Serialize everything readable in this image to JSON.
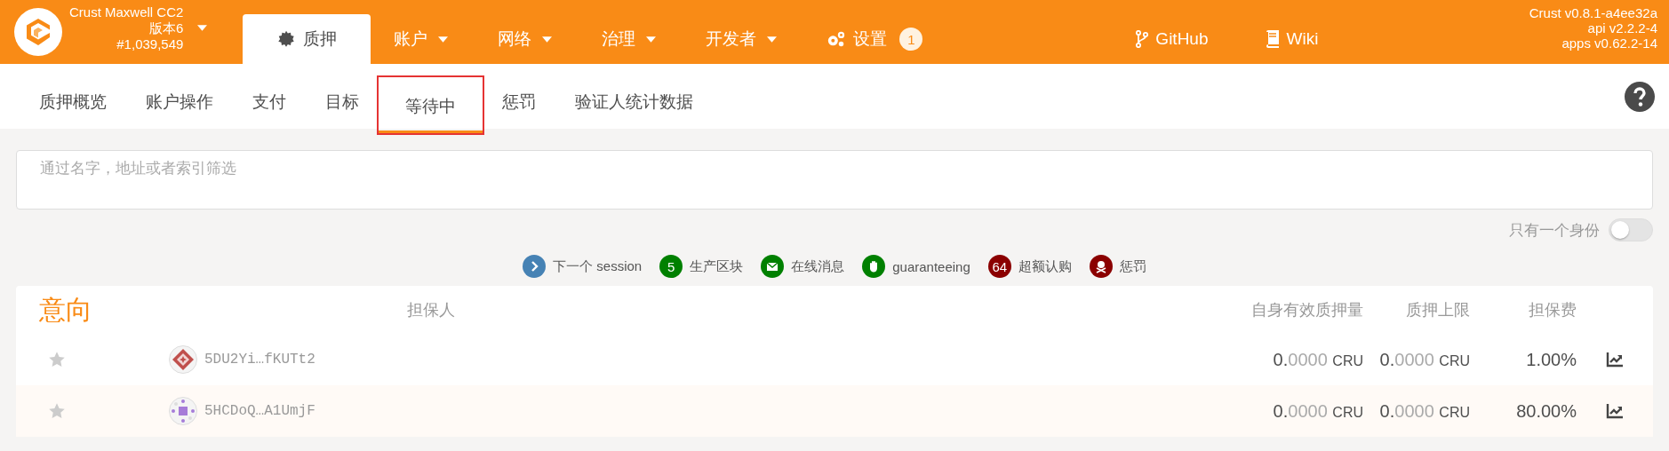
{
  "chain": {
    "name": "Crust Maxwell CC2",
    "version": "版本6",
    "block": "#1,039,549"
  },
  "nav": [
    {
      "label": "质押",
      "selected": true,
      "dropdown": false
    },
    {
      "label": "账户",
      "selected": false,
      "dropdown": true
    },
    {
      "label": "网络",
      "selected": false,
      "dropdown": true
    },
    {
      "label": "治理",
      "selected": false,
      "dropdown": true
    },
    {
      "label": "开发者",
      "selected": false,
      "dropdown": true
    },
    {
      "label": "设置",
      "selected": false,
      "dropdown": false,
      "badge": "1"
    }
  ],
  "links": [
    {
      "label": "GitHub"
    },
    {
      "label": "Wiki"
    }
  ],
  "versions": [
    "Crust v0.8.1-a4ee32a",
    "api v2.2.2-4",
    "apps v0.62.2-14"
  ],
  "tabs": [
    {
      "label": "质押概览",
      "selected": false
    },
    {
      "label": "账户操作",
      "selected": false
    },
    {
      "label": "支付",
      "selected": false
    },
    {
      "label": "目标",
      "selected": false
    },
    {
      "label": "等待中",
      "selected": true,
      "highlighted": true
    },
    {
      "label": "惩罚",
      "selected": false
    },
    {
      "label": "验证人统计数据",
      "selected": false
    }
  ],
  "filter": {
    "placeholder": "通过名字，地址或者索引筛选"
  },
  "only_one_identity": {
    "label": "只有一个身份",
    "on": false
  },
  "legend": [
    {
      "kind": "icon",
      "color": "#4682b4",
      "label": "下一个 session"
    },
    {
      "kind": "count",
      "color": "#008000",
      "count": "5",
      "label": "生产区块"
    },
    {
      "kind": "icon",
      "color": "#008000",
      "label": "在线消息"
    },
    {
      "kind": "icon",
      "color": "#008000",
      "label": "guaranteeing"
    },
    {
      "kind": "count",
      "color": "#8b0000",
      "count": "64",
      "label": "超额认购"
    },
    {
      "kind": "icon",
      "color": "#8b0000",
      "label": "惩罚"
    }
  ],
  "table": {
    "title": "意向",
    "columns": [
      "担保人",
      "自身有效质押量",
      "质押上限",
      "担保费"
    ],
    "rows": [
      {
        "favorite": false,
        "address": "5DU2Yi…fKUTt2",
        "own_stake": {
          "whole": "0.",
          "fraction": "0000",
          "unit": "CRU"
        },
        "limit": {
          "whole": "0.",
          "fraction": "0000",
          "unit": "CRU"
        },
        "fee": "1.00%"
      },
      {
        "favorite": false,
        "address": "5HCDoQ…A1UmjF",
        "own_stake": {
          "whole": "0.",
          "fraction": "0000",
          "unit": "CRU"
        },
        "limit": {
          "whole": "0.",
          "fraction": "0000",
          "unit": "CRU"
        },
        "fee": "80.00%"
      }
    ]
  }
}
